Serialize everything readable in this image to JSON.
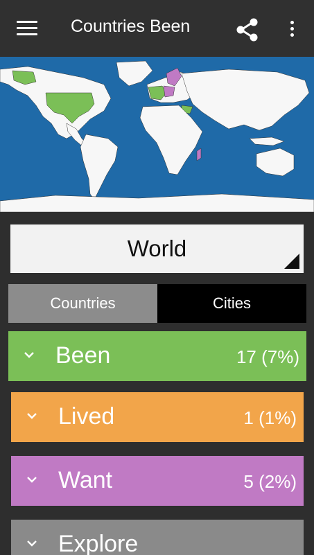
{
  "appbar": {
    "title": "Countries Been"
  },
  "region_selector": {
    "value": "World"
  },
  "tabs": [
    {
      "label": "Countries",
      "selected": true
    },
    {
      "label": "Cities",
      "selected": false
    }
  ],
  "categories": [
    {
      "label": "Been",
      "count": "17 (7%)",
      "color": "#7bbf57"
    },
    {
      "label": "Lived",
      "count": "1 (1%)",
      "color": "#f2a54a"
    },
    {
      "label": "Want",
      "count": "5 (2%)",
      "color": "#c07ac4"
    },
    {
      "label": "Explore",
      "count": "",
      "color": "#8a8a8a"
    }
  ],
  "colors": {
    "ocean": "#1f6aa8",
    "land": "#f7f7f7",
    "been": "#7bbf57",
    "want": "#c07ac4"
  }
}
